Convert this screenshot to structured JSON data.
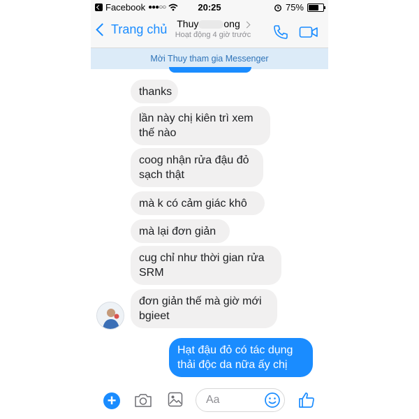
{
  "status_bar": {
    "carrier": "Facebook",
    "signal": "●●●○○",
    "time": "20:25",
    "battery": "75%",
    "battery_level": 0.75
  },
  "header": {
    "back_label": "Trang chủ",
    "contact_name": "Thuy",
    "contact_name_suffix": "ong",
    "status": "Hoạt động 4 giờ trước"
  },
  "invite_banner": "Mời Thuy tham gia Messenger",
  "messages": [
    {
      "direction": "in",
      "text": "thanks"
    },
    {
      "direction": "in",
      "text": "lần này chị kiên trì xem\nthế nào"
    },
    {
      "direction": "in",
      "text": "coog nhận rửa đậu đỏ\nsạch thật"
    },
    {
      "direction": "in",
      "text": "mà k có cảm giác khô"
    },
    {
      "direction": "in",
      "text": "mà lại đơn giản"
    },
    {
      "direction": "in",
      "text": "cug chỉ như thời gian rửa\nSRM"
    },
    {
      "direction": "in",
      "text": "đơn giản thế mà giờ mới\nbgieet"
    },
    {
      "direction": "out",
      "text": "Hạt đậu đỏ có tác dụng\nthải độc da nữa ấy chị"
    }
  ],
  "composer": {
    "placeholder": "Aa"
  },
  "colors": {
    "accent": "#1a8cff",
    "incoming_bubble": "#f1f0f0",
    "banner": "#dcebf8"
  },
  "icons": [
    "back-chevron-icon",
    "phone-icon",
    "video-camera-icon",
    "plus-icon",
    "camera-icon",
    "image-icon",
    "emoji-icon",
    "thumbs-up-icon"
  ]
}
